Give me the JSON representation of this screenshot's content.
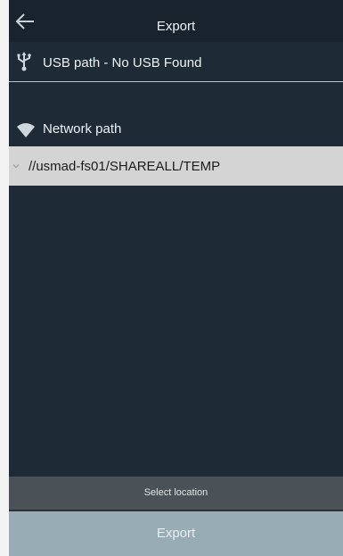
{
  "header": {
    "title": "Export",
    "back_icon": "arrow-left-icon"
  },
  "usb": {
    "icon": "usb-icon",
    "label": "USB path - No USB Found"
  },
  "network": {
    "icon": "wifi-icon",
    "label": "Network path",
    "paths": [
      {
        "icon": "chevron-down-icon",
        "label": "//usmad-fs01/SHAREALL/TEMP"
      }
    ]
  },
  "footer": {
    "status": "Select location",
    "export_label": "Export"
  },
  "colors": {
    "panel_bg": "#1e2b37",
    "header_bg": "#18232d",
    "selected_row_bg": "#d4d4d4",
    "status_bar_bg": "#4b5257",
    "export_button_bg": "#98acb6"
  }
}
